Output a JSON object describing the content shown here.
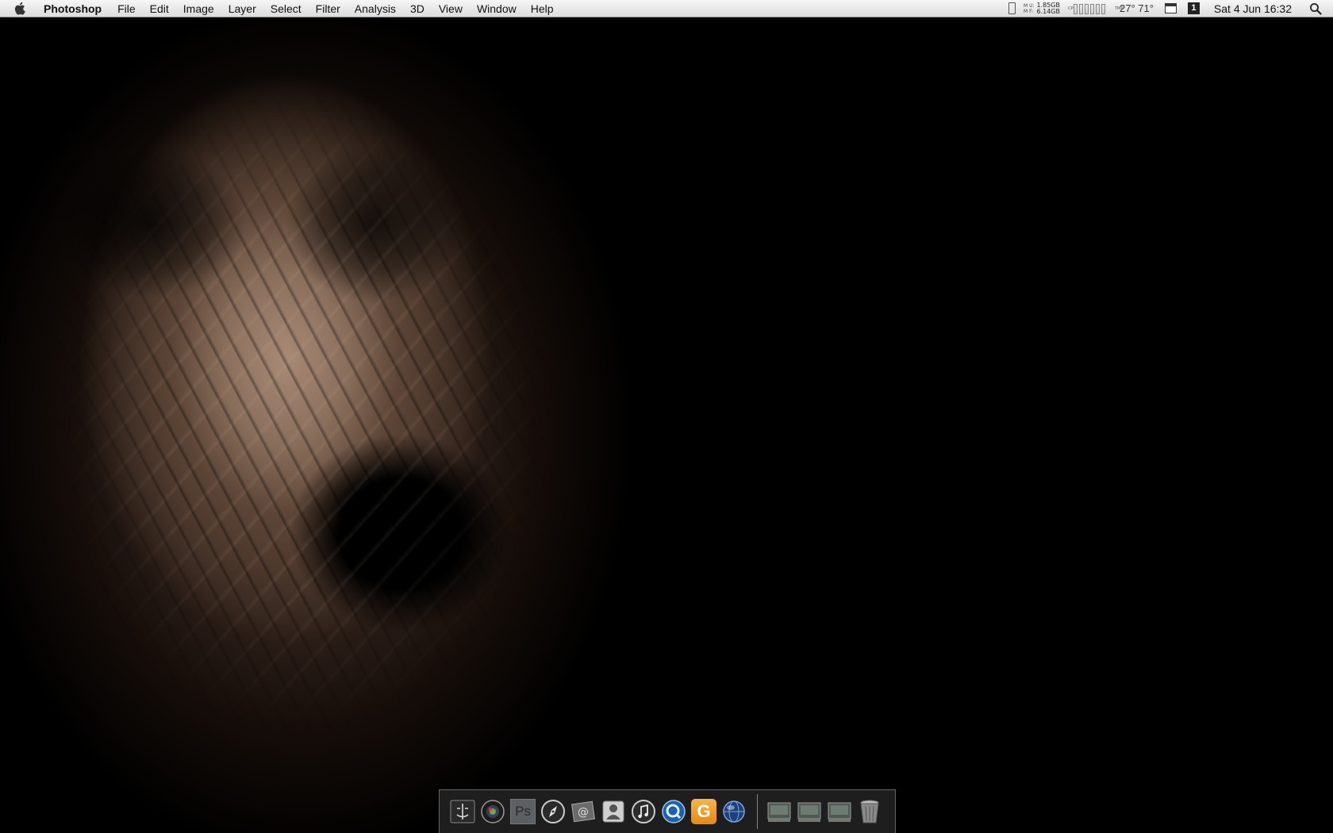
{
  "menubar": {
    "app_name": "Photoshop",
    "menus": [
      "File",
      "Edit",
      "Image",
      "Layer",
      "Select",
      "Filter",
      "Analysis",
      "3D",
      "View",
      "Window",
      "Help"
    ],
    "memory": {
      "labels": [
        "M U:",
        "M F:"
      ],
      "used": "1.85GB",
      "free": "6.14GB"
    },
    "cpu_label": "CPU",
    "temp_label": "TMP",
    "temperature": "27° 71°",
    "clock": "Sat 4 Jun  16:32"
  },
  "icons": {
    "menubar": [
      "apple-icon",
      "battery-icon",
      "memory-meter-icon",
      "cpu-meter-icon",
      "temperature-meter-icon",
      "calendar-icon",
      "spaces-icon",
      "spotlight-icon"
    ],
    "dock_apps": [
      "finder-icon",
      "photo-booth-icon",
      "photoshop-icon",
      "safari-icon",
      "mail-icon",
      "address-book-icon",
      "itunes-icon",
      "quicktime-icon",
      "growl-icon",
      "network-globe-icon"
    ],
    "dock_others": [
      "stack-drive-icon",
      "stack-drive-icon",
      "stack-drive-icon",
      "trash-icon"
    ]
  },
  "dock": {
    "ps_label": "Ps",
    "growl_label": "G",
    "spaces_number": "1"
  },
  "colors": {
    "menubar_top": "#f6f6f6",
    "menubar_bottom": "#dcdcdc",
    "desktop_bg": "#000000",
    "wallpaper_skin": "#8a6e5c",
    "growl_orange": "#e68a12"
  }
}
